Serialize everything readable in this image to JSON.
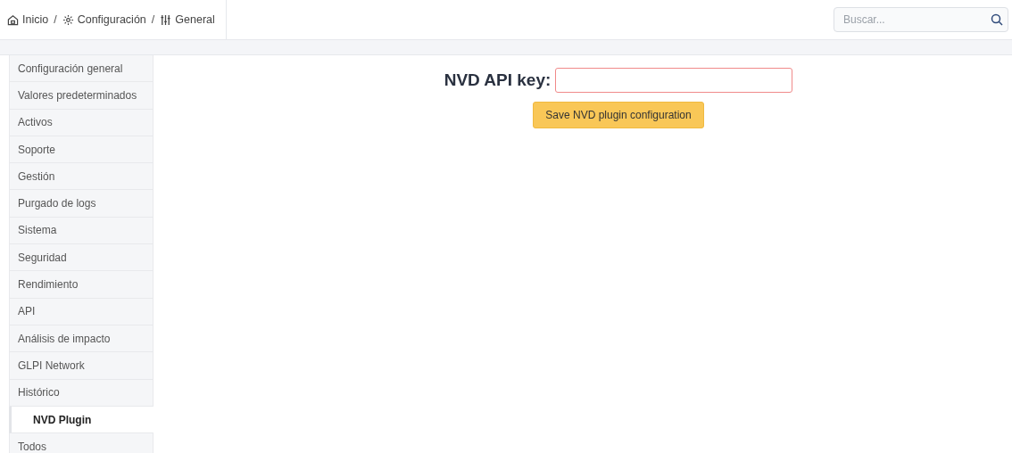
{
  "breadcrumb": [
    {
      "label": "Inicio",
      "kind": "home"
    },
    {
      "label": "Configuración",
      "kind": "gear",
      "separator": "/"
    },
    {
      "label": "General",
      "kind": "sliders",
      "separator": "/"
    }
  ],
  "search": {
    "placeholder": "Buscar..."
  },
  "sidebar": {
    "items": [
      {
        "label": "Configuración general",
        "selected": false
      },
      {
        "label": "Valores predeterminados",
        "selected": false
      },
      {
        "label": "Activos",
        "selected": false
      },
      {
        "label": "Soporte",
        "selected": false
      },
      {
        "label": "Gestión",
        "selected": false
      },
      {
        "label": "Purgado de logs",
        "selected": false
      },
      {
        "label": "Sistema",
        "selected": false
      },
      {
        "label": "Seguridad",
        "selected": false
      },
      {
        "label": "Rendimiento",
        "selected": false
      },
      {
        "label": "API",
        "selected": false
      },
      {
        "label": "Análisis de impacto",
        "selected": false
      },
      {
        "label": "GLPI Network",
        "selected": false
      },
      {
        "label": "Histórico",
        "selected": false
      },
      {
        "label": "NVD Plugin",
        "selected": true
      },
      {
        "label": "Todos",
        "selected": false
      }
    ]
  },
  "form": {
    "label": "NVD API key:",
    "field": {
      "invalid": true
    },
    "button": "Save NVD plugin configuration"
  }
}
